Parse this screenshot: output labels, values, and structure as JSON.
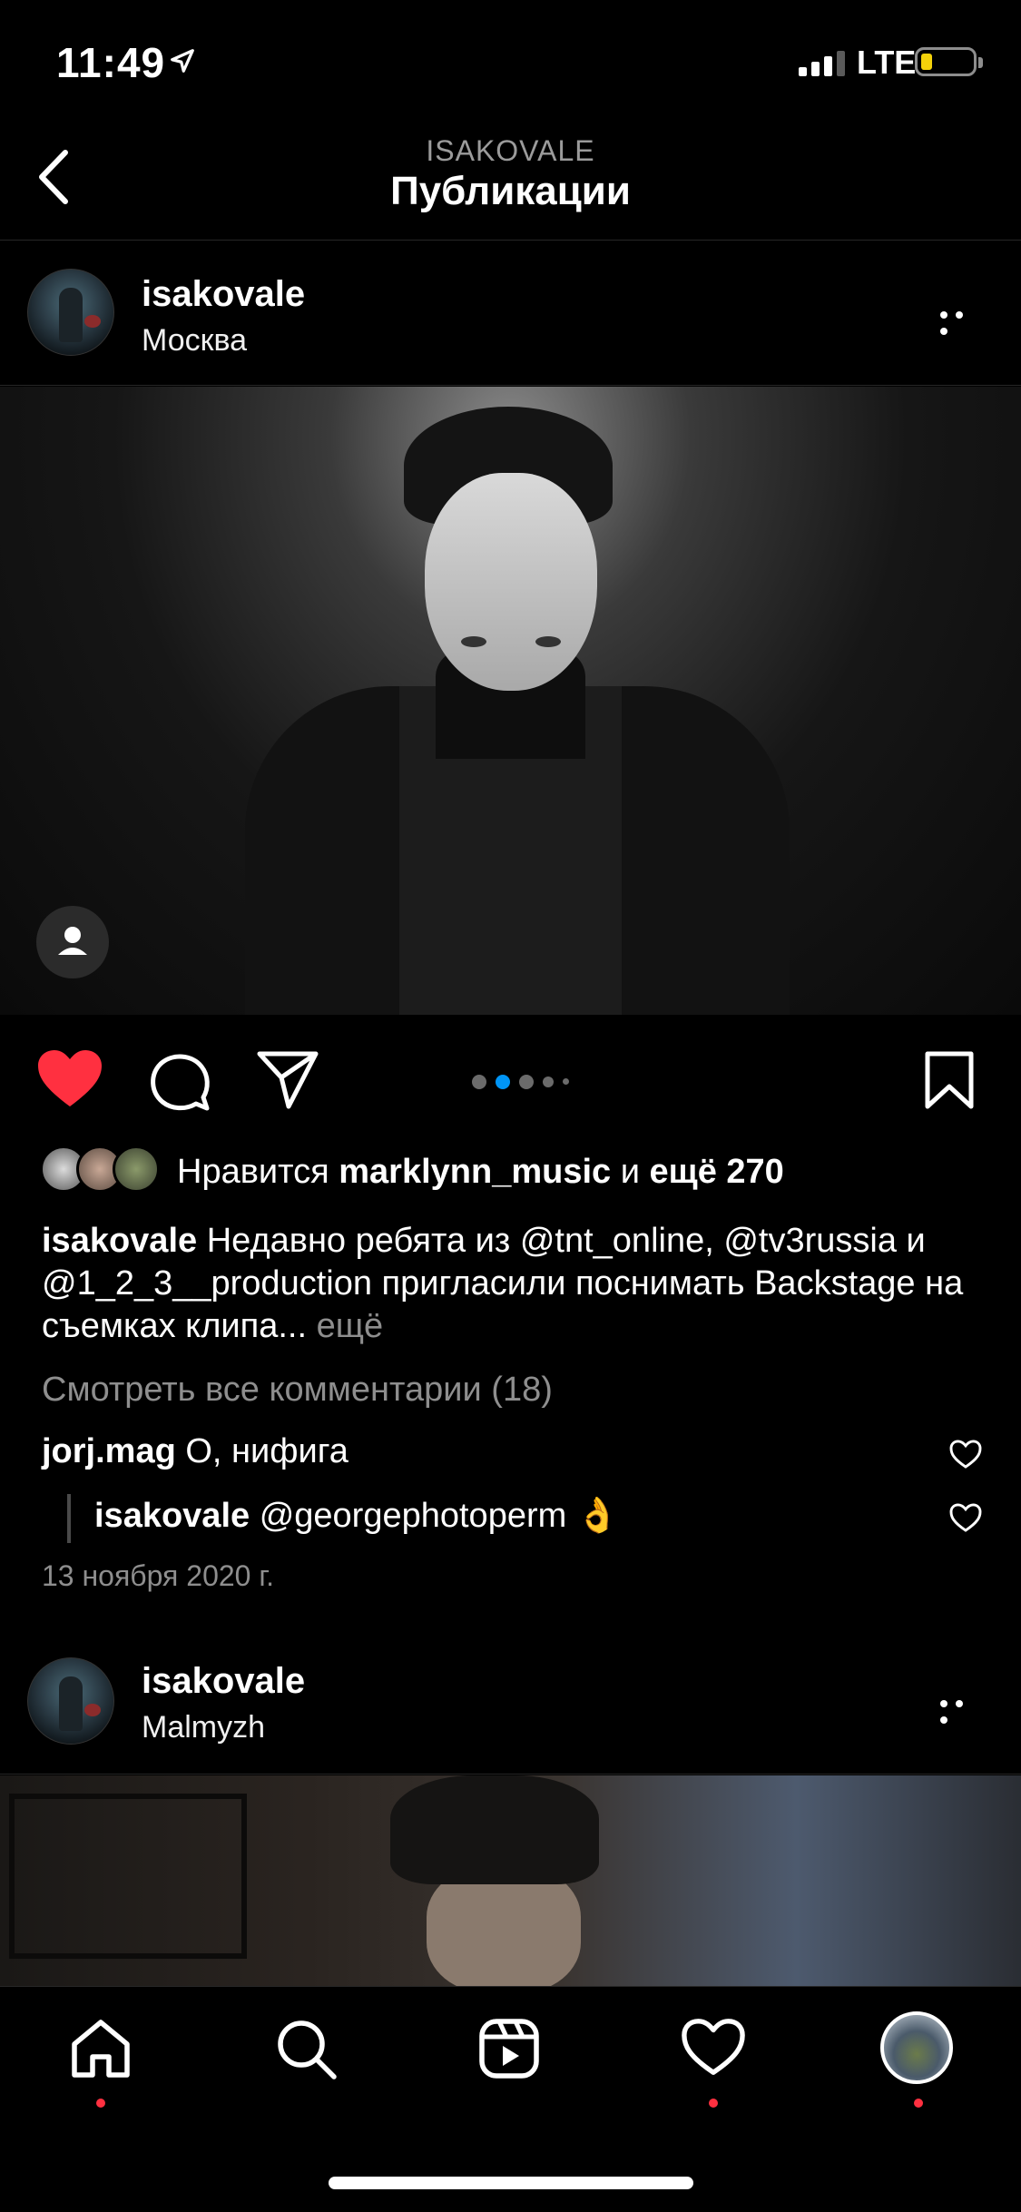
{
  "status_bar": {
    "time": "11:49",
    "network": "LTE",
    "battery_level": 0.15,
    "battery_color": "#f4d20a"
  },
  "header": {
    "subtitle": "ISAKOVALE",
    "title": "Публикации",
    "back_icon": "chevron-left-icon"
  },
  "posts": [
    {
      "username": "isakovale",
      "location": "Москва",
      "liked": true,
      "like_color": "#ff3040",
      "carousel_total": 5,
      "carousel_active": 2,
      "likes_prefix": "Нравится",
      "likes_user": "marklynn_music",
      "likes_middle": "и",
      "likes_more": "ещё 270",
      "caption_user": "isakovale",
      "caption_text": "Недавно ребята из @tnt_online, @tv3russia и @1_2_3__production пригласили поснимать Backstage на съемках клипа...",
      "caption_more": "ещё",
      "view_comments": "Смотреть все комментарии (18)",
      "comments": [
        {
          "user": "jorj.mag",
          "text": "О, нифига"
        },
        {
          "user": "isakovale",
          "text": "@georgephotoperm 👌"
        }
      ],
      "date": "13 ноября 2020 г."
    },
    {
      "username": "isakovale",
      "location": "Malmyzh"
    }
  ],
  "tab_bar": {
    "items": [
      "home-icon",
      "search-icon",
      "reels-icon",
      "activity-heart-icon",
      "profile-avatar"
    ],
    "notification_color": "#ff3040"
  }
}
